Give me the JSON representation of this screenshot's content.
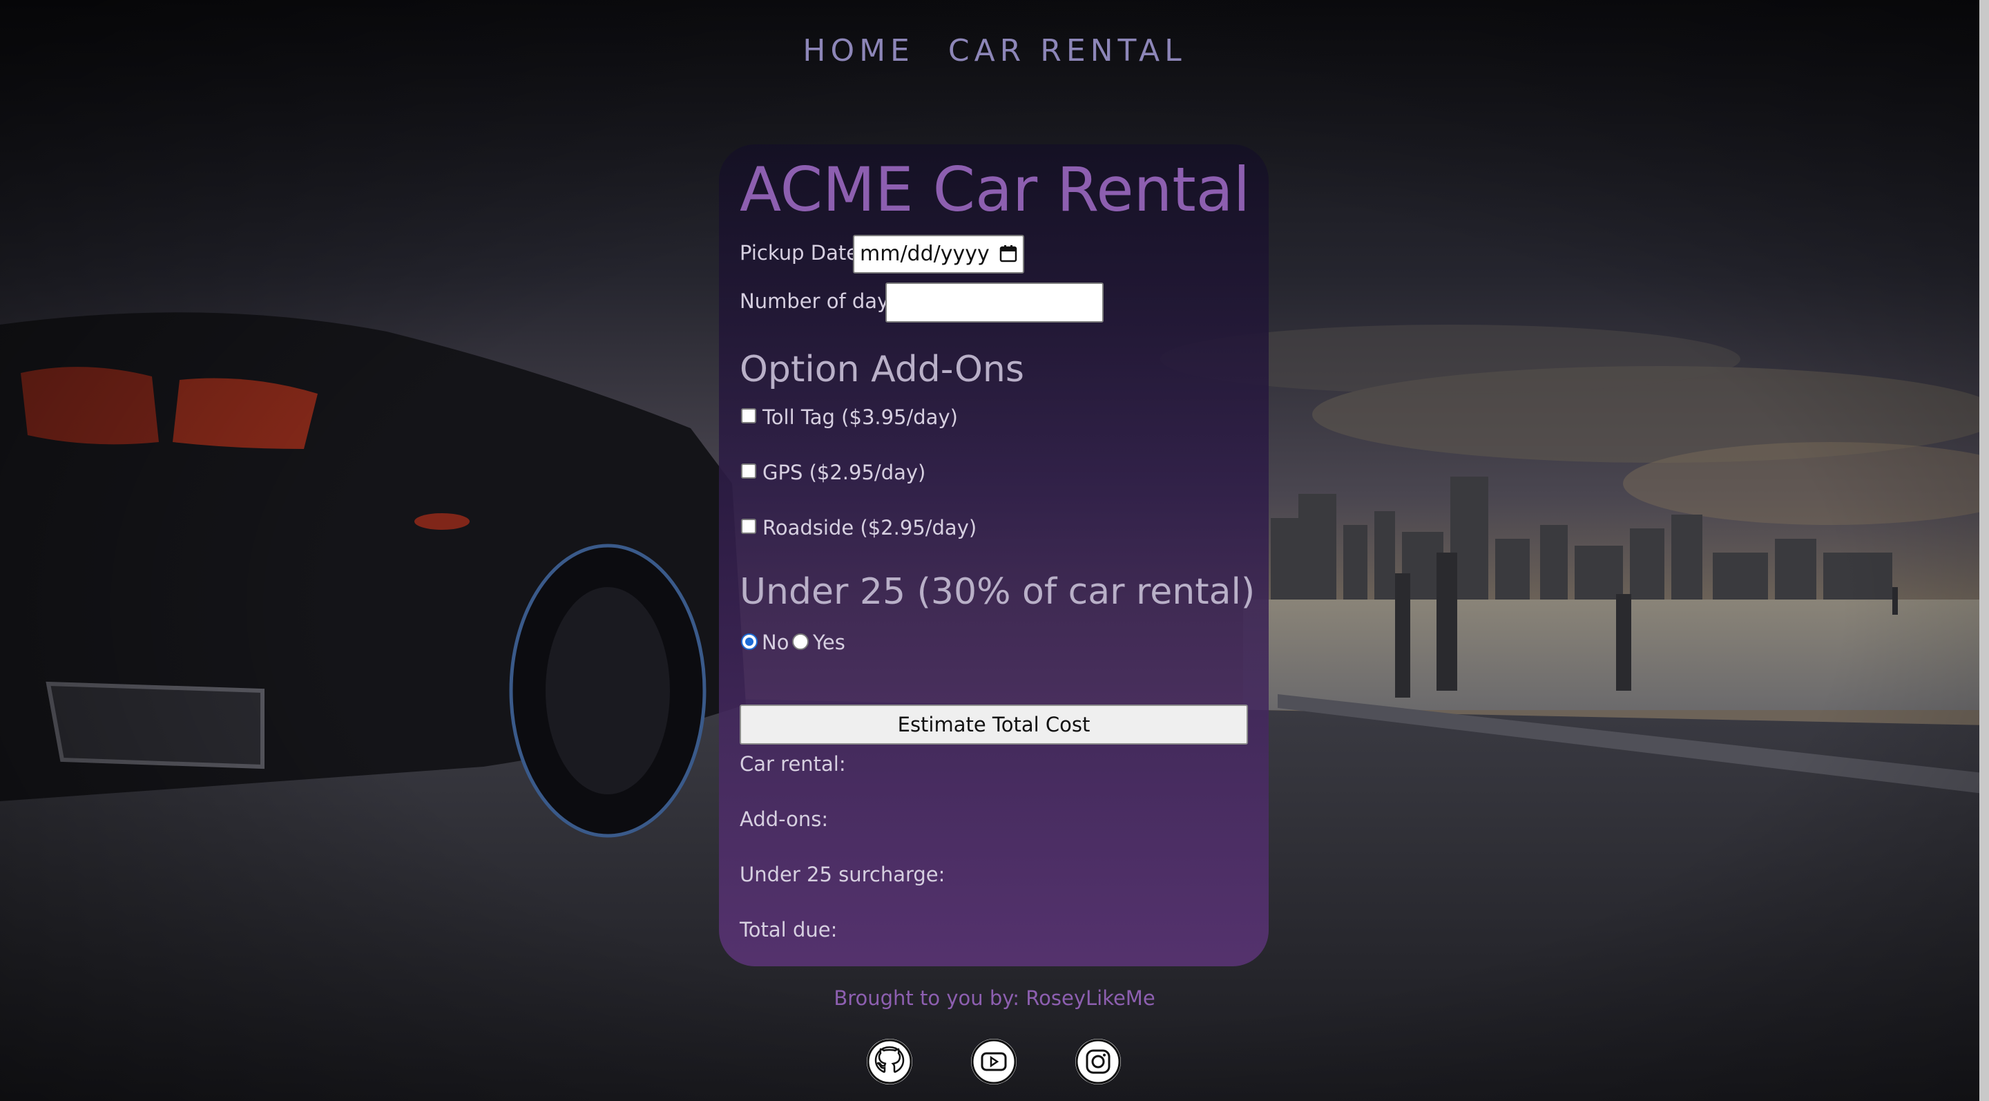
{
  "nav": {
    "items": [
      {
        "label": "HOME"
      },
      {
        "label": "CAR RENTAL"
      }
    ]
  },
  "form": {
    "title": "ACME Car Rental",
    "pickup_label": "Pickup Date:",
    "pickup_placeholder": "mm/dd/yyyy",
    "days_label": "Number of days:",
    "days_value": "",
    "addons_heading": "Option Add-Ons",
    "addons": [
      {
        "label": "Toll Tag ($3.95/day)",
        "checked": false
      },
      {
        "label": "GPS ($2.95/day)",
        "checked": false
      },
      {
        "label": "Roadside ($2.95/day)",
        "checked": false
      }
    ],
    "under25_heading": "Under 25 (30% of car rental)",
    "under25_options": [
      {
        "label": "No",
        "checked": true
      },
      {
        "label": "Yes",
        "checked": false
      }
    ],
    "estimate_button": "Estimate Total Cost",
    "results": {
      "car_rental": "Car rental:",
      "addons": "Add-ons:",
      "surcharge": "Under 25 surcharge:",
      "total": "Total due:"
    }
  },
  "footer": {
    "credit": "Brought to you by: RoseyLikeMe",
    "social": [
      {
        "icon": "github-icon"
      },
      {
        "icon": "youtube-icon"
      },
      {
        "icon": "instagram-icon"
      }
    ]
  },
  "colors": {
    "accent": "#8d5fb0",
    "nav": "#8d86b8",
    "radio_selected": "#1d6bd6"
  }
}
